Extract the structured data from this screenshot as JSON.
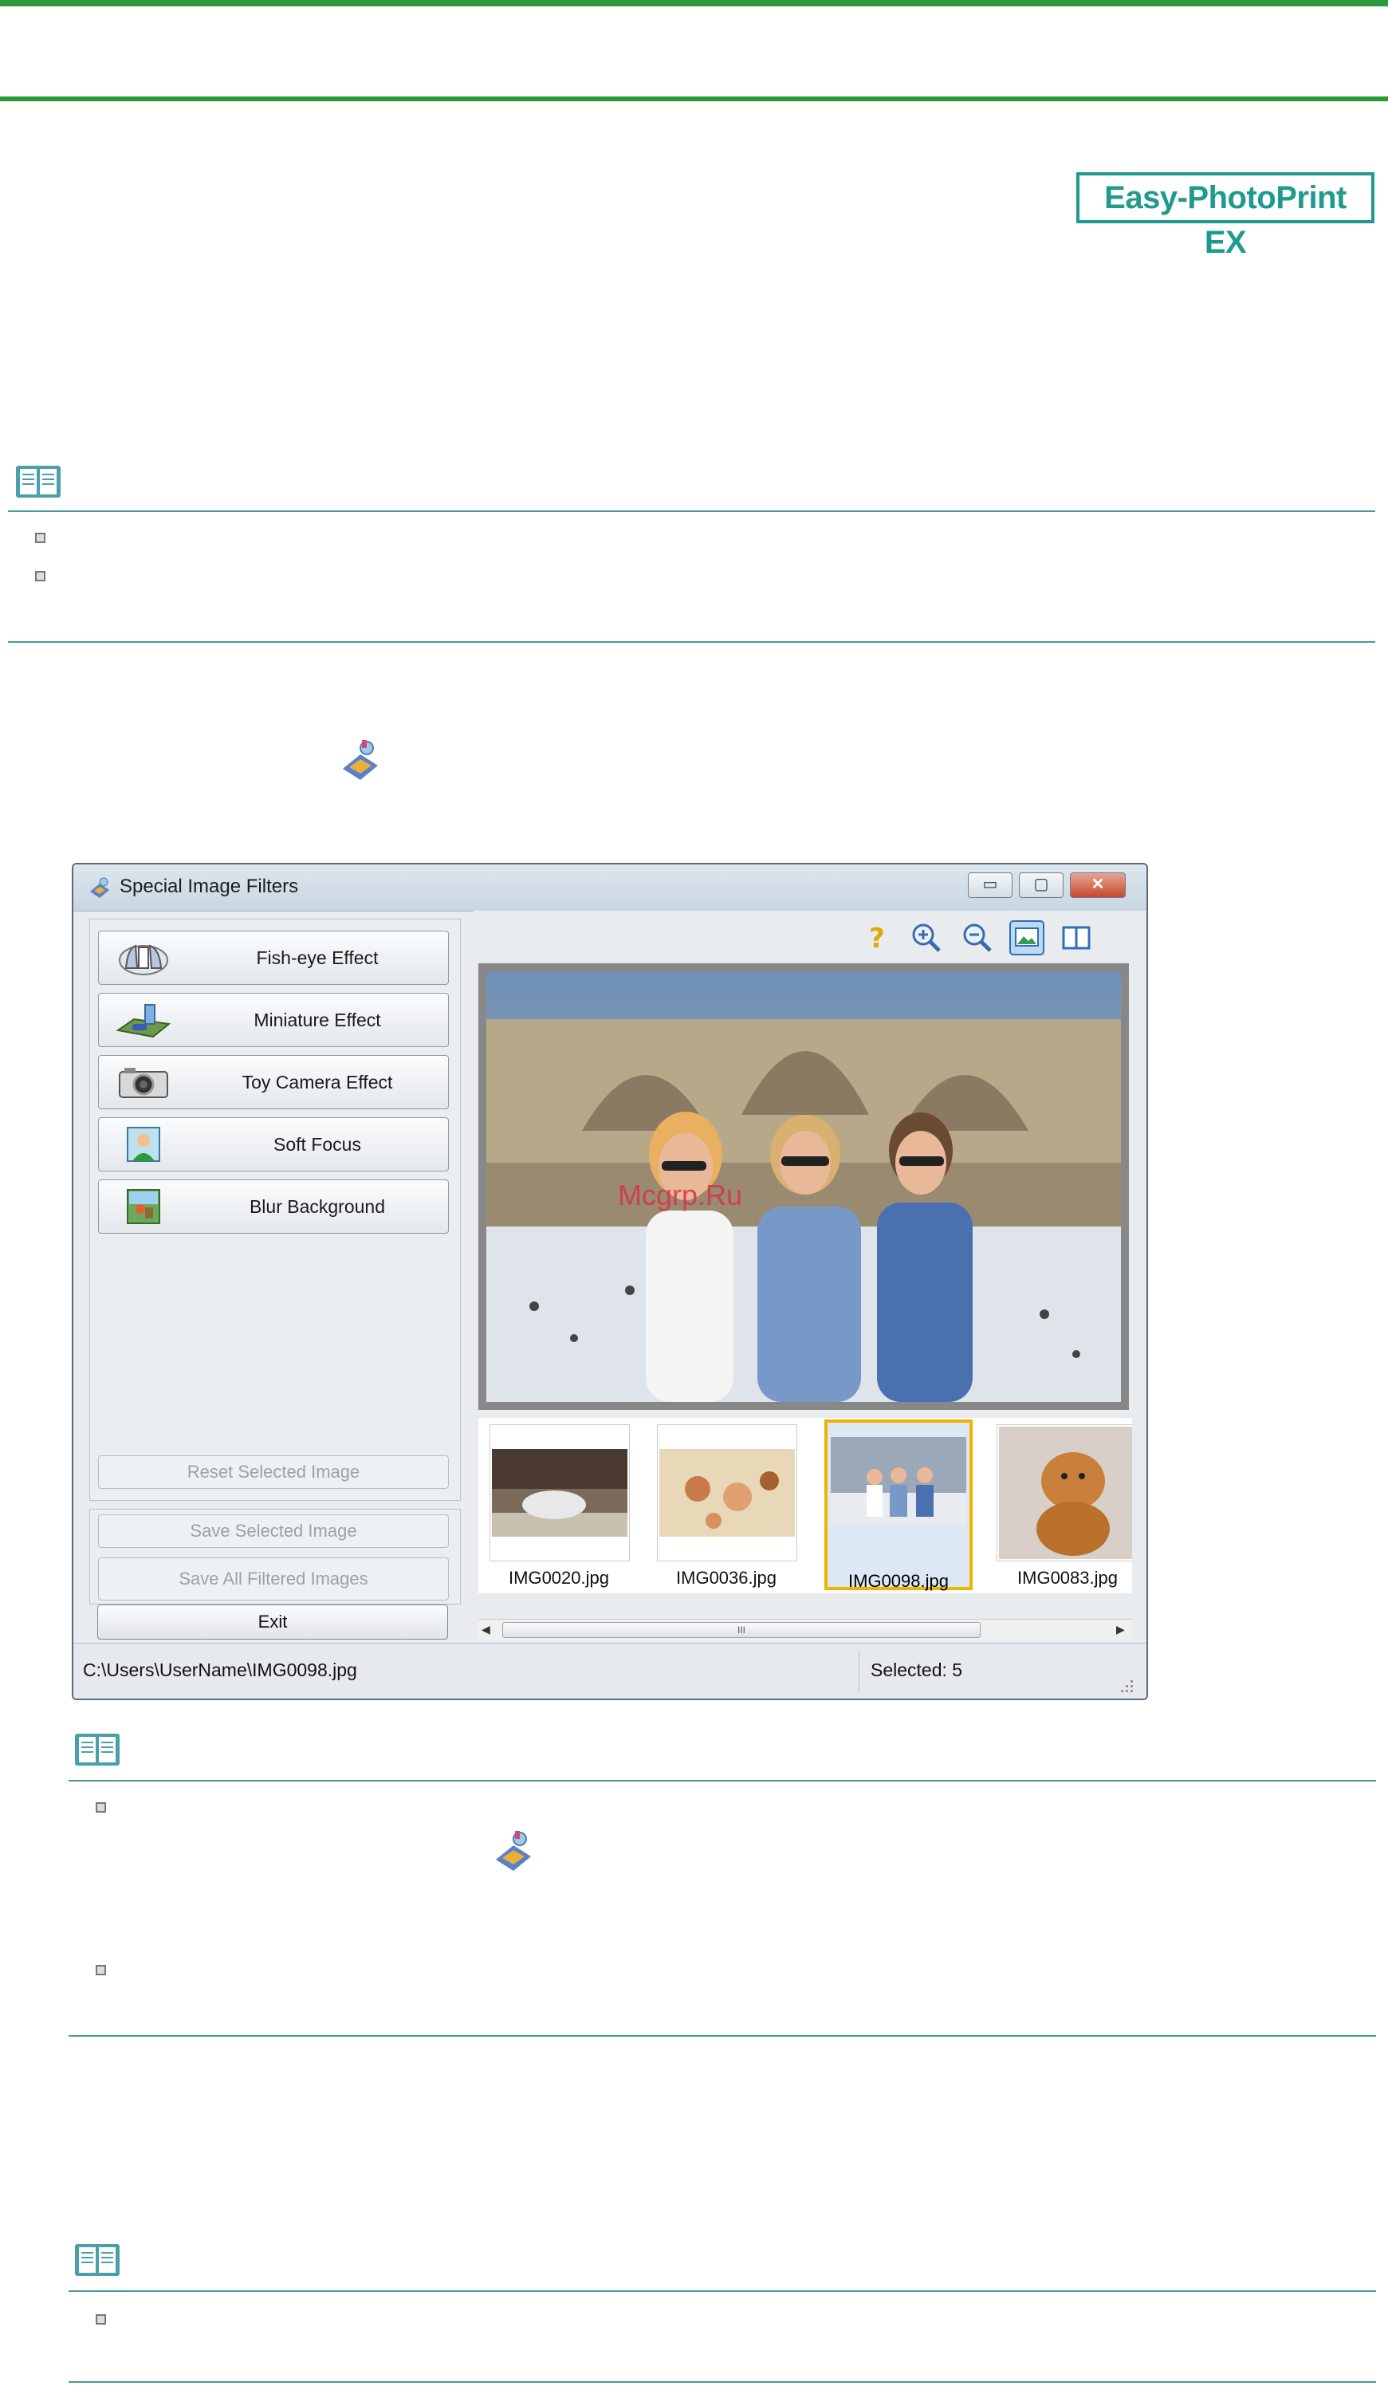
{
  "header": {
    "brand_label": "Easy-PhotoPrint EX"
  },
  "window": {
    "title": "Special Image Filters",
    "controls": {
      "minimize": "▭",
      "maximize": "▢",
      "close": "✕"
    },
    "filters": [
      {
        "label": "Fish-eye Effect",
        "icon": "fisheye-icon"
      },
      {
        "label": "Miniature Effect",
        "icon": "miniature-icon"
      },
      {
        "label": "Toy Camera Effect",
        "icon": "camera-icon"
      },
      {
        "label": "Soft Focus",
        "icon": "soft-focus-icon"
      },
      {
        "label": "Blur Background",
        "icon": "blur-background-icon"
      }
    ],
    "reset_label": "Reset Selected Image",
    "save_selected_label": "Save Selected Image",
    "save_all_label": "Save All Filtered Images",
    "exit_label": "Exit",
    "thumbnails": [
      {
        "name": "IMG0020.jpg",
        "selected": false
      },
      {
        "name": "IMG0036.jpg",
        "selected": false
      },
      {
        "name": "IMG0098.jpg",
        "selected": true
      },
      {
        "name": "IMG0083.jpg",
        "selected": false
      }
    ],
    "scroll_grip": "III",
    "status": {
      "path": "C:\\Users\\UserName\\IMG0098.jpg",
      "selected": "Selected: 5"
    },
    "selected_color": "#f0b400"
  },
  "watermark": "Mcgrp.Ru"
}
